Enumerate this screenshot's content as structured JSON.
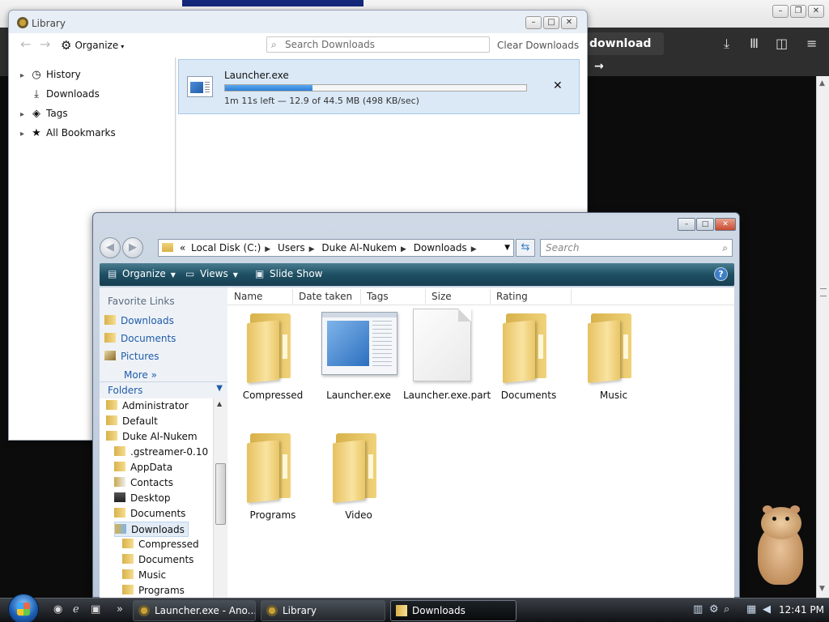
{
  "browser": {
    "download_button": "download",
    "icons": [
      "download-arrow-icon",
      "library-icon",
      "sidebar-icon",
      "menu-icon"
    ]
  },
  "library": {
    "title": "Library",
    "organize_label": "Organize",
    "search_placeholder": "Search Downloads",
    "clear_label": "Clear Downloads",
    "sidebar": [
      {
        "label": "History",
        "icon": "clock-icon"
      },
      {
        "label": "Downloads",
        "icon": "download-icon"
      },
      {
        "label": "Tags",
        "icon": "tag-icon"
      },
      {
        "label": "All Bookmarks",
        "icon": "star-icon"
      }
    ],
    "download": {
      "name": "Launcher.exe",
      "status": "1m 11s left — 12.9 of 44.5 MB (498 KB/sec)",
      "progress": 0.29
    }
  },
  "explorer": {
    "address": [
      "Local Disk (C:)",
      "Users",
      "Duke Al-Nukem",
      "Downloads"
    ],
    "address_prefix": "«",
    "search_placeholder": "Search",
    "commands": {
      "organize": "Organize",
      "views": "Views",
      "slideshow": "Slide Show"
    },
    "favorites_title": "Favorite Links",
    "favorites": [
      "Downloads",
      "Documents",
      "Pictures"
    ],
    "more_label": "More",
    "folders_label": "Folders",
    "tree": [
      {
        "label": "Administrator",
        "indent": 0
      },
      {
        "label": "Default",
        "indent": 0
      },
      {
        "label": "Duke Al-Nukem",
        "indent": 0
      },
      {
        "label": ".gstreamer-0.10",
        "indent": 1
      },
      {
        "label": "AppData",
        "indent": 1
      },
      {
        "label": "Contacts",
        "indent": 1
      },
      {
        "label": "Desktop",
        "indent": 1
      },
      {
        "label": "Documents",
        "indent": 1
      },
      {
        "label": "Downloads",
        "indent": 1
      },
      {
        "label": "Compressed",
        "indent": 2
      },
      {
        "label": "Documents",
        "indent": 2
      },
      {
        "label": "Music",
        "indent": 2
      },
      {
        "label": "Programs",
        "indent": 2
      }
    ],
    "columns": [
      "Name",
      "Date taken",
      "Tags",
      "Size",
      "Rating"
    ],
    "files": [
      {
        "label": "Compressed",
        "type": "folder"
      },
      {
        "label": "Launcher.exe",
        "type": "exe"
      },
      {
        "label": "Launcher.exe.part",
        "type": "blank"
      },
      {
        "label": "Documents",
        "type": "folder"
      },
      {
        "label": "Music",
        "type": "folder"
      },
      {
        "label": "Programs",
        "type": "folder"
      },
      {
        "label": "Video",
        "type": "folder"
      }
    ]
  },
  "taskbar": {
    "tasks": [
      {
        "label": "Launcher.exe - Ano..."
      },
      {
        "label": "Library"
      },
      {
        "label": "Downloads"
      }
    ],
    "clock": "12:41 PM"
  },
  "colors": {
    "accent": "#1f5ba8",
    "command_bar": "#1e4f63",
    "progress": "#2c7fd6"
  }
}
